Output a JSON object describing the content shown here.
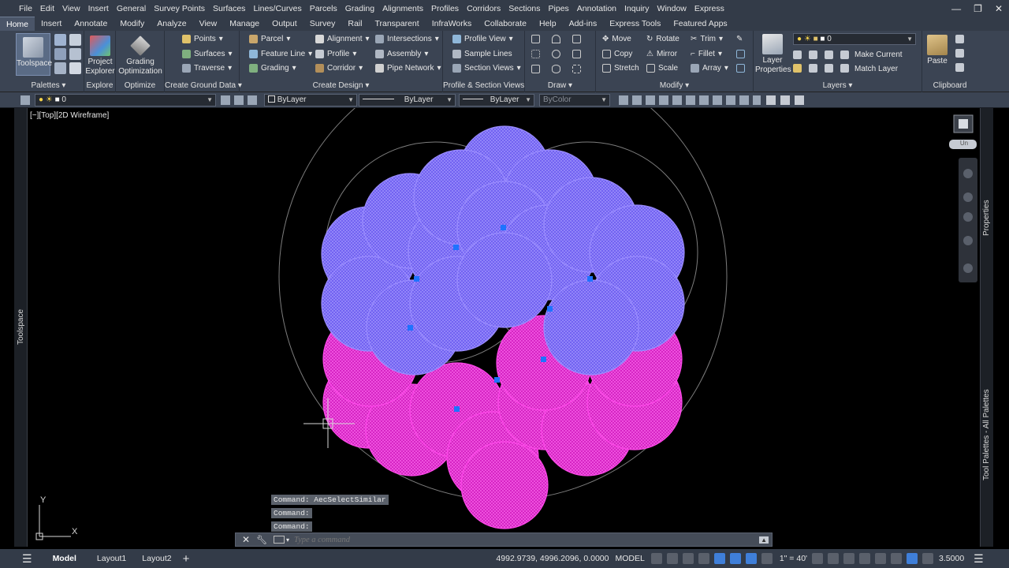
{
  "menu": [
    "File",
    "Edit",
    "View",
    "Insert",
    "General",
    "Survey Points",
    "Surfaces",
    "Lines/Curves",
    "Parcels",
    "Grading",
    "Alignments",
    "Profiles",
    "Corridors",
    "Sections",
    "Pipes",
    "Annotation",
    "Inquiry",
    "Window",
    "Express"
  ],
  "window_controls": {
    "minimize": "—",
    "restore": "❐",
    "close": "✕"
  },
  "tabs": [
    "Home",
    "Insert",
    "Annotate",
    "Modify",
    "Analyze",
    "View",
    "Manage",
    "Output",
    "Survey",
    "Rail",
    "Transparent",
    "InfraWorks",
    "Collaborate",
    "Help",
    "Add-ins",
    "Express Tools",
    "Featured Apps"
  ],
  "ribbon": {
    "palettes": {
      "title": "Palettes",
      "toolspace": "Toolspace"
    },
    "explore": {
      "title": "Explore",
      "project_explorer": "Project Explorer"
    },
    "optimize": {
      "title": "Optimize",
      "grading_optimization": "Grading Optimization"
    },
    "ground": {
      "title": "Create Ground Data",
      "items": [
        "Points",
        "Surfaces",
        "Traverse"
      ]
    },
    "design": {
      "title": "Create Design",
      "col1": [
        "Parcel",
        "Feature Line",
        "Grading"
      ],
      "col2": [
        "Alignment",
        "Profile",
        "Corridor"
      ],
      "col3": [
        "Intersections",
        "Assembly",
        "Pipe Network"
      ]
    },
    "profile": {
      "title": "Profile & Section Views",
      "items": [
        "Profile View",
        "Sample Lines",
        "Section Views"
      ]
    },
    "draw": {
      "title": "Draw"
    },
    "modify": {
      "title": "Modify",
      "col1": [
        "Move",
        "Copy",
        "Stretch"
      ],
      "col2": [
        "Rotate",
        "Mirror",
        "Scale"
      ],
      "col3": [
        "Trim",
        "Fillet",
        "Array"
      ]
    },
    "layers": {
      "title": "Layers",
      "layer_properties": "Layer Properties",
      "current_layer": "0",
      "make_current": "Make Current",
      "match_layer": "Match Layer"
    },
    "clipboard": {
      "title": "Clipboard",
      "paste": "Paste"
    }
  },
  "properties_bar": {
    "layer": "0",
    "color": "ByLayer",
    "linetype": "ByLayer",
    "lineweight": "ByLayer",
    "plotstyle": "ByColor"
  },
  "left_palette": "Toolspace",
  "right_palettes": {
    "properties": "Properties",
    "tool_palettes": "Tool Palettes - All Palettes"
  },
  "viewport": {
    "label": "[−][Top][2D Wireframe]",
    "viewcube_un": "Un"
  },
  "command": {
    "history": [
      "Command: AecSelectSimilar",
      "Command:",
      "Command:"
    ],
    "placeholder": "Type a command"
  },
  "ucs": {
    "x": "X",
    "y": "Y"
  },
  "status": {
    "layouts": [
      "Model",
      "Layout1",
      "Layout2"
    ],
    "coords": "4992.9739, 4996.2096, 0.0000",
    "space": "MODEL",
    "scale": "1\" = 40'",
    "value": "3.5000"
  },
  "colors": {
    "blue": "#7b6cf6",
    "magenta": "#ff2ee2",
    "ribbon": "#3b4453",
    "menubar": "#333b48"
  }
}
